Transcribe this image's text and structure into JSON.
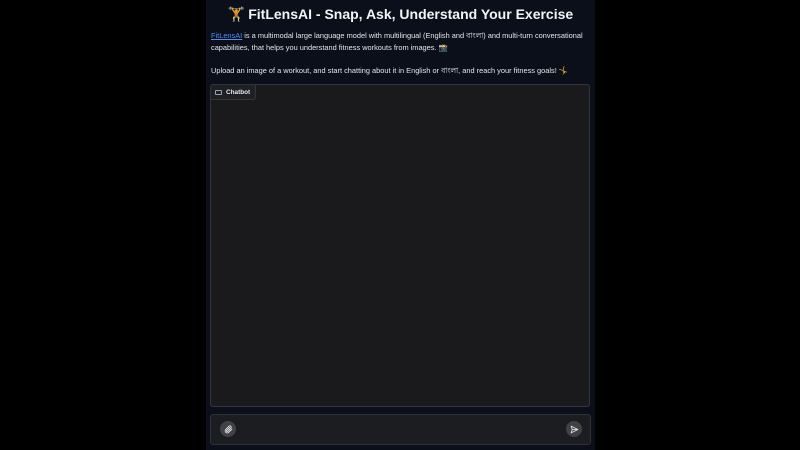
{
  "header": {
    "emoji": "🏋",
    "title": "FitLensAI - Snap, Ask, Understand Your Exercise"
  },
  "intro": {
    "link_text": "FitLensAI",
    "text": " is a multimodal large language model with multilingual (English and বাংলা) and multi-turn conversational capabilities, that helps you understand fitness workouts from images. 📸"
  },
  "instructions": {
    "text": "Upload an image of a workout, and start chatting about it in English or বাংলা, and reach your fitness goals! 🤸"
  },
  "chatbot": {
    "label": "Chatbot",
    "icon": "chat-icon"
  },
  "input": {
    "placeholder": "",
    "value": "",
    "attach_icon": "paperclip-icon",
    "send_icon": "send-icon"
  },
  "colors": {
    "page_bg": "#000000",
    "app_bg": "#0b0f19",
    "link": "#4f8cf7",
    "panel_bg": "#1a1a1d",
    "button_bg": "#404246"
  }
}
